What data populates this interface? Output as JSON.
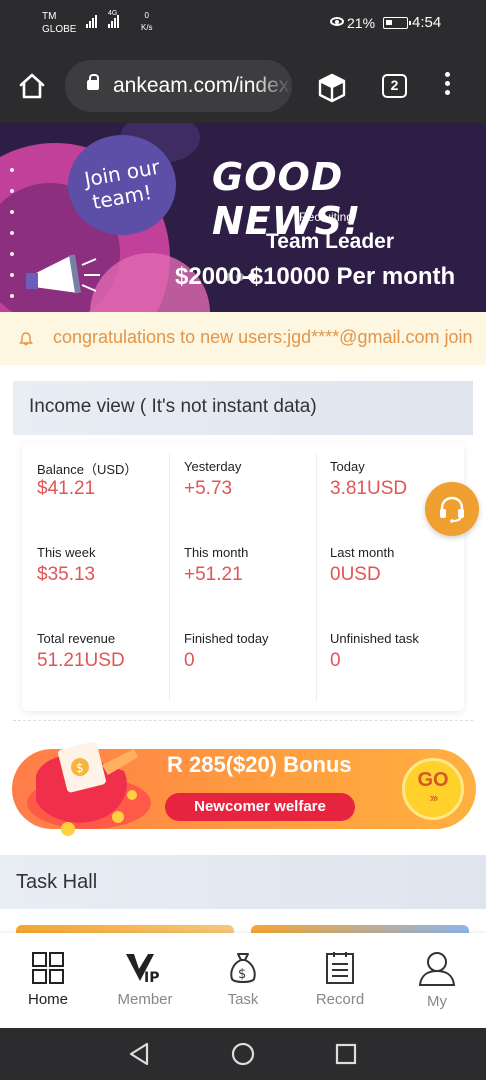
{
  "status_bar": {
    "carrier_line1": "TM",
    "carrier_line2": "GLOBE",
    "network_type": "4G",
    "net_speed_value": "0",
    "net_speed_unit": "K/s",
    "battery": "21%",
    "time": "4:54"
  },
  "browser": {
    "url": "ankeam.com/index",
    "tab_count": "2"
  },
  "banner": {
    "join_line1": "Join our",
    "join_line2": "team!",
    "headline": "GOOD NEWS!",
    "recruiting": "Recruiting",
    "position": "Team Leader",
    "salary": "$2000-$10000 Per month"
  },
  "notice": {
    "message": "congratulations to new users:jgd****@gmail.com join"
  },
  "income": {
    "title": "Income view ( It's not instant data)",
    "cells": [
      {
        "label": "Balance（USD）",
        "value": "$41.21"
      },
      {
        "label": "Yesterday",
        "value": "+5.73"
      },
      {
        "label": "Today",
        "value": "3.81USD"
      },
      {
        "label": "This week",
        "value": "$35.13"
      },
      {
        "label": "This month",
        "value": "+51.21"
      },
      {
        "label": "Last month",
        "value": "0USD"
      },
      {
        "label": "Total revenue",
        "value": "51.21USD"
      },
      {
        "label": "Finished today",
        "value": "0"
      },
      {
        "label": "Unfinished task",
        "value": "0"
      }
    ]
  },
  "bonus": {
    "title": "R 285($20) Bonus",
    "pill": "Newcomer welfare",
    "go": "GO",
    "go_arrows": "›››"
  },
  "task_hall": {
    "title": "Task Hall"
  },
  "bottom_nav": {
    "items": [
      {
        "label": "Home",
        "icon": "home-grid-icon"
      },
      {
        "label": "Member",
        "icon": "vip-icon"
      },
      {
        "label": "Task",
        "icon": "money-bag-icon"
      },
      {
        "label": "Record",
        "icon": "record-icon"
      },
      {
        "label": "My",
        "icon": "user-icon"
      }
    ],
    "vip_text": "IP"
  },
  "colors": {
    "value_red": "#e05555",
    "notice_text": "#e3964a",
    "accent_orange": "#f0a030"
  }
}
